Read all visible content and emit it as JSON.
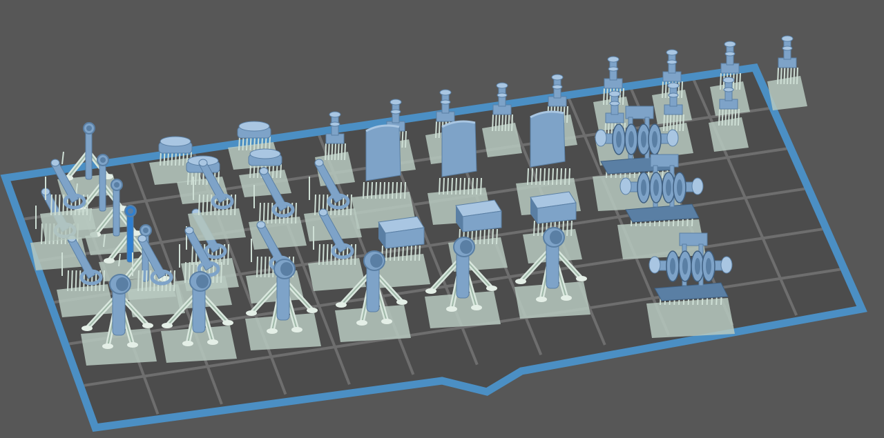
{
  "app": {
    "view": "3d-build-plate-viewport",
    "labels": []
  },
  "colors": {
    "background": "#575757",
    "plate_surface": "#4c4c4c",
    "plate_grid": "#6e6e6e",
    "plate_border": "#4b8fc4",
    "model_fill": "#7ea3c8",
    "model_dark": "#5a7fa4",
    "model_light": "#a9c6e2",
    "selected_model": "#2f7fd0",
    "support_pad": "#b7c9bf",
    "support_pin": "#cfe0d6"
  },
  "scene": {
    "model_groups": [
      {
        "name": "curved-pipe-stand",
        "count": 5
      },
      {
        "name": "rounded-cap-part",
        "count": 4
      },
      {
        "name": "angled-bracket-part",
        "count": 11
      },
      {
        "name": "bollard-post-part",
        "count": 12
      },
      {
        "name": "curved-panel-part",
        "count": 3
      },
      {
        "name": "box-block-part",
        "count": 3
      },
      {
        "name": "vent-pipe-tripod",
        "count": 6
      },
      {
        "name": "winch-gear-assembly",
        "count": 3
      }
    ],
    "selected_model": "curved-pipe-stand"
  }
}
